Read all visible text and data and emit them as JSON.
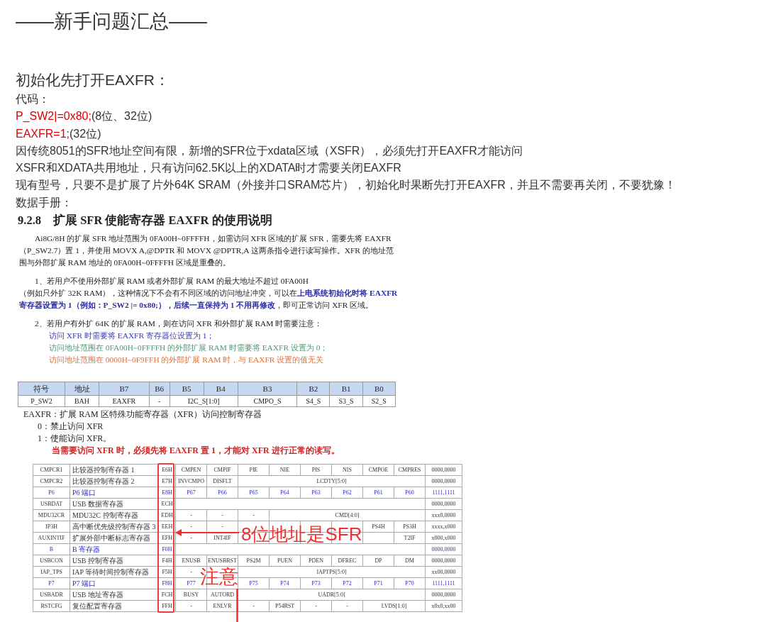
{
  "title": "——新手问题汇总——",
  "section_heading": "初始化先打开EAXFR：",
  "lines": [
    {
      "kind": "plain",
      "text": "代码："
    },
    {
      "kind": "code",
      "code": "P_SW2|=0x80;",
      "comment": "(8位、32位)"
    },
    {
      "kind": "code",
      "code": "EAXFR=1;",
      "comment": "(32位)"
    },
    {
      "kind": "plain",
      "text": "因传统8051的SFR地址空间有限，新增的SFR位于xdata区域（XSFR），必须先打开EAXFR才能访问"
    },
    {
      "kind": "plain",
      "text": "XSFR和XDATA共用地址，只有访问62.5K以上的XDATA时才需要关闭EAXFR"
    },
    {
      "kind": "plain",
      "text": "现有型号，只要不是扩展了片外64K SRAM（外接并口SRAM芯片），初始化时果断先打开EAXFR，并且不需要再关闭，不要犹豫！"
    },
    {
      "kind": "plain",
      "text": "数据手册："
    }
  ],
  "datasheet": {
    "heading": "9.2.8　扩展 SFR 使能寄存器 EAXFR 的使用说明",
    "paragraphs": [
      {
        "lines": [
          [
            {
              "text": "Ai8G/8H 的扩展 SFR 地址范围为 0FA00H~0FFFFH，如需访问 XFR 区域的扩展 SFR，需要先将 EAXFR"
            }
          ],
          [
            {
              "text": "（P_SW2.7）置 1，并使用 MOVX A,@DPTR 和 MOVX @DPTR,A 这两条指令进行读写操作。XFR 的地址范"
            }
          ],
          [
            {
              "text": "围与外部扩展 RAM 地址的 0FA00H~0FFFFH 区域是重叠的。"
            }
          ]
        ]
      },
      {
        "lines": [
          [
            {
              "text": "1、若用户不使用外部扩展 RAM 或者外部扩展 RAM 的最大地址不超过 0FA00H"
            }
          ],
          [
            {
              "text": "（例如只外扩 32K RAM），这种情况下不会有不同区域的访问地址冲突，可以在"
            },
            {
              "text": "上电系统初始化时将 EAXFR",
              "color": "#2e2ea8",
              "bold": true
            }
          ],
          [
            {
              "text": "寄存器设置为 1（例如：P_SW2 |= 0x80;），后续一直保持为 1 不用再修改",
              "color": "#2e2ea8",
              "bold": true
            },
            {
              "text": "，即可正常访问 XFR 区域。"
            }
          ]
        ]
      },
      {
        "lines": [
          [
            {
              "text": "2、若用户有外扩 64K 的扩展 RAM，则在访问 XFR 和外部扩展 RAM 时需要注意："
            }
          ],
          [
            {
              "text": "访问 XFR 时需要将 EAXFR 寄存器位设置为 1；",
              "color": "#3a3ab0"
            }
          ],
          [
            {
              "text": "访问地址范围在 0FA00H~0FFFFH 的外部扩展 RAM 时需要将 EAXFR 设置为 0；",
              "color": "#4a9a72"
            }
          ],
          [
            {
              "text": "访问地址范围在 0000H~0F9FFH 的外部扩展 RAM 时，与 EAXFR 设置的值无关",
              "color": "#e0703a"
            }
          ]
        ]
      }
    ]
  },
  "register_table": {
    "columns": [
      "符号",
      "地址",
      "B7",
      "B6",
      "B5",
      "B4",
      "B3",
      "B2",
      "B1",
      "B0"
    ],
    "row": [
      {
        "text": "P_SW2"
      },
      {
        "text": "BAH"
      },
      {
        "text": "EAXFR"
      },
      {
        "text": "-"
      },
      {
        "text": "I2C_S[1:0]",
        "kind": "field"
      },
      {
        "text": "CMPO_S"
      },
      {
        "text": "S4_S"
      },
      {
        "text": "S3_S"
      },
      {
        "text": "S2_S"
      }
    ]
  },
  "notes": [
    {
      "text": "EAXFR：扩展 RAM 区特殊功能寄存器（XFR）访问控制寄存器",
      "kind": "definition"
    },
    {
      "text": "0：禁止访问 XFR",
      "kind": "value"
    },
    {
      "text": "1：使能访问 XFR。",
      "kind": "value"
    },
    {
      "text": "当需要访问 XFR 时，必须先将 EAXFR 置 1，才能对 XFR 进行正常的读写。",
      "kind": "warning"
    }
  ],
  "sfr_table": {
    "rows": [
      {
        "kind": "register",
        "name": "CMPCR1",
        "desc": "比较器控制寄存器 1",
        "addr": "E6H",
        "bits": [
          "CMPEN",
          "CMPIF",
          "PIE",
          "NIE",
          "PIS",
          "NIS",
          "CMPOE",
          "CMPRES"
        ],
        "reset": "0000,0000"
      },
      {
        "kind": "register",
        "name": "CMPCR2",
        "desc": "比较器控制寄存器 2",
        "addr": "E7H",
        "bits": [
          "INVCMPO",
          "DISFLT",
          {
            "text": "LCDTY[5:0]",
            "kind": "field"
          }
        ],
        "reset": "0000,0000"
      },
      {
        "kind": "port",
        "name": "P6",
        "desc": "P6 端口",
        "addr": "E8H",
        "bits": [
          "P67",
          "P66",
          "P65",
          "P64",
          "P63",
          "P62",
          "P61",
          "P60"
        ],
        "reset": "1111,1111"
      },
      {
        "kind": "register",
        "name": "USBDAT",
        "desc": "USB 数据寄存器",
        "addr": "ECH",
        "reset": "0000,0000"
      },
      {
        "kind": "register",
        "name": "MDU32CR",
        "desc": "MDU32C 控制寄存器",
        "addr": "EDH",
        "bits": [
          "-",
          "-",
          "-",
          {
            "text": "CMD[4:0]",
            "kind": "field"
          }
        ],
        "reset": "xxx0,0000"
      },
      {
        "kind": "register",
        "name": "IP3H",
        "desc": "高中断优先级控制寄存器 3",
        "addr": "EEH",
        "bits": [
          "-",
          "-",
          {
            "kind": "covered"
          },
          {
            "kind": "covered"
          },
          {
            "kind": "covered"
          },
          {
            "kind": "covered"
          },
          "PS4H",
          "PS3H"
        ],
        "reset": "xxxx,x000"
      },
      {
        "kind": "register",
        "name": "AUXINTIF",
        "desc": "扩展外部中断标志寄存器",
        "addr": "EFH",
        "bits": [
          "-",
          "INT4IF",
          {
            "kind": "covered"
          },
          {
            "kind": "covered"
          },
          {
            "kind": "covered"
          },
          {
            "kind": "covered"
          },
          {
            "kind": "covered"
          },
          "T2IF"
        ],
        "reset": "x000,x000"
      },
      {
        "kind": "port",
        "name": "B",
        "desc": "B 寄存器",
        "addr": "F0H",
        "reset": "0000,0000"
      },
      {
        "kind": "register",
        "name": "USBCON",
        "desc": "USB 控制寄存器",
        "addr": "F4H",
        "bits": [
          "ENUSB",
          "ENUSBRST",
          "PS2M",
          "PUEN",
          "PDEN",
          "DFREC",
          "DP",
          "DM"
        ],
        "reset": "0000,0000"
      },
      {
        "kind": "register",
        "name": "IAP_TPS",
        "desc": "IAP 等待时间控制寄存器",
        "addr": "F5H",
        "bits": [
          "-",
          {
            "kind": "covered"
          },
          {
            "text": "IAPTPS[5:0]",
            "kind": "field"
          }
        ],
        "reset": "xx00,0000"
      },
      {
        "kind": "port",
        "name": "P7",
        "desc": "P7 端口",
        "addr": "F8H",
        "bits": [
          "P77",
          {
            "kind": "covered"
          },
          "P75",
          "P74",
          "P73",
          "P72",
          "P71",
          "P70"
        ],
        "reset": "1111,1111"
      },
      {
        "kind": "register",
        "name": "USBADR",
        "desc": "USB 地址寄存器",
        "addr": "FCH",
        "bits": [
          "BUSY",
          "AUTORD",
          {
            "text": "UADR[5:0]",
            "kind": "field"
          }
        ],
        "reset": "0000,0000"
      },
      {
        "kind": "register",
        "name": "RSTCFG",
        "desc": "复位配置寄存器",
        "addr": "FFH",
        "bits": [
          "-",
          "ENLVR",
          "-",
          "P54RST",
          "-",
          "-",
          {
            "text": "LVDS[1:0]",
            "kind": "field"
          }
        ],
        "reset": "x0x0,xx00"
      }
    ],
    "annotations": [
      {
        "kind": "arrow-left",
        "text": "8位地址是SFR"
      },
      {
        "kind": "arrow-down",
        "text": "注意"
      }
    ]
  }
}
